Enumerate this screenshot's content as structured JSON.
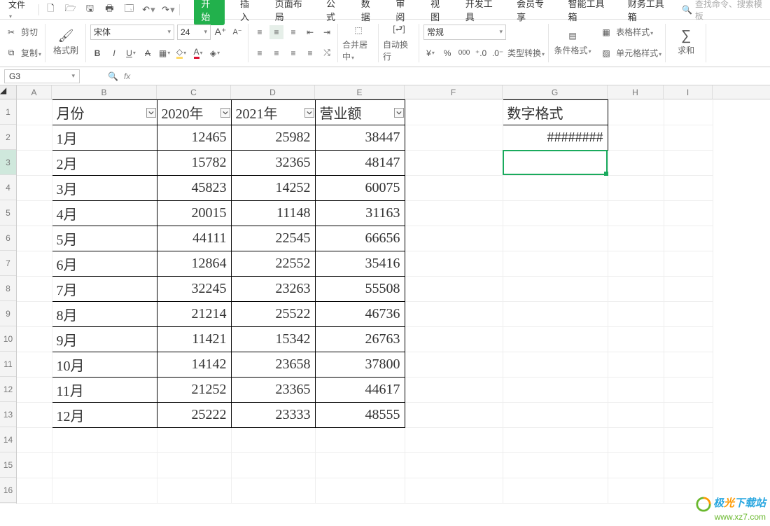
{
  "menu": {
    "file": "文件",
    "qat_icons": [
      "new",
      "open",
      "save",
      "print",
      "preview",
      "undo",
      "redo"
    ],
    "tabs": [
      "开始",
      "插入",
      "页面布局",
      "公式",
      "数据",
      "审阅",
      "视图",
      "开发工具",
      "会员专享",
      "智能工具箱",
      "财务工具箱"
    ],
    "active_tab": "开始",
    "search_placeholder": "查找命令、搜索模板"
  },
  "ribbon": {
    "clipboard": {
      "cut": "剪切",
      "copy": "复制",
      "brush": "格式刷"
    },
    "font": {
      "name": "宋体",
      "size": "24",
      "increase": "A",
      "decrease": "A"
    },
    "align": {
      "merge": "合并居中",
      "wrap": "自动换行"
    },
    "number": {
      "format": "常规",
      "type_convert": "类型转换"
    },
    "styles": {
      "cond": "条件格式",
      "table_style": "表格样式",
      "cell_style": "单元格样式"
    },
    "sum": {
      "label": "求和"
    }
  },
  "namebox": "G3",
  "headers": [
    "A",
    "B",
    "C",
    "D",
    "E",
    "F",
    "G",
    "H",
    "I"
  ],
  "row_numbers": [
    "1",
    "2",
    "3",
    "4",
    "5",
    "6",
    "7",
    "8",
    "9",
    "10",
    "11",
    "12",
    "13",
    "14",
    "15",
    "16"
  ],
  "table": {
    "head": [
      "月份",
      "2020年",
      "2021年",
      "营业额"
    ],
    "rows": [
      [
        "1月",
        "12465",
        "25982",
        "38447"
      ],
      [
        "2月",
        "15782",
        "32365",
        "48147"
      ],
      [
        "3月",
        "45823",
        "14252",
        "60075"
      ],
      [
        "4月",
        "20015",
        "11148",
        "31163"
      ],
      [
        "5月",
        "44111",
        "22545",
        "66656"
      ],
      [
        "6月",
        "12864",
        "22552",
        "35416"
      ],
      [
        "7月",
        "32245",
        "23263",
        "55508"
      ],
      [
        "8月",
        "21214",
        "25522",
        "46736"
      ],
      [
        "9月",
        "11421",
        "15342",
        "26763"
      ],
      [
        "10月",
        "14142",
        "23658",
        "37800"
      ],
      [
        "11月",
        "21252",
        "23365",
        "44617"
      ],
      [
        "12月",
        "25222",
        "23333",
        "48555"
      ]
    ]
  },
  "g_column": {
    "head": "数字格式",
    "row2": "########"
  },
  "watermark": {
    "brand_a": "极",
    "brand_b": "光",
    "brand_c": "下载站",
    "url": "www.xz7.com"
  }
}
